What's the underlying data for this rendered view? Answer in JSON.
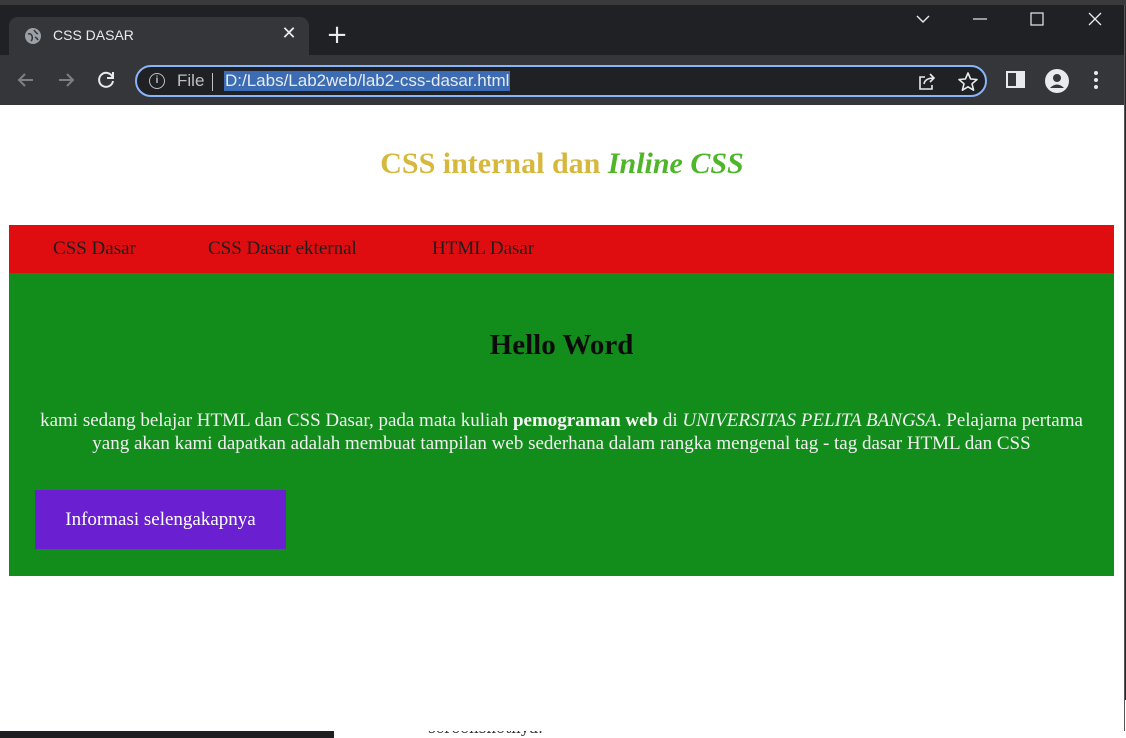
{
  "browser": {
    "tab_title": "CSS DASAR",
    "tab_close": "✕",
    "new_tab": "+",
    "omnibox": {
      "scheme_label": "File",
      "url": "D:/Labs/Lab2web/lab2-css-dasar.html"
    },
    "icons": {
      "favicon": "globe-icon",
      "back": "arrow-left-icon",
      "forward": "arrow-right-icon",
      "reload": "reload-icon",
      "info": "info-icon",
      "share": "share-icon",
      "bookmark": "star-icon",
      "sidepanel": "side-panel-icon",
      "profile": "profile-icon",
      "menu": "kebab-menu-icon"
    },
    "colors": {
      "frame": "#202124",
      "toolbar": "#35363a",
      "focus": "#8ab4f8"
    }
  },
  "page": {
    "heading_part1": "CSS internal dan ",
    "heading_part2": "Inline CSS",
    "nav": [
      "CSS Dasar",
      "CSS Dasar ekternal",
      "HTML Dasar"
    ],
    "main": {
      "title": "Hello Word",
      "para": {
        "t1": "kami sedang belajar HTML dan CSS Dasar, pada mata kuliah ",
        "bold": "pemograman web",
        "t2": " di ",
        "italic": "UNIVERSITAS PELITA BANGSA",
        "t3": ". Pelajarna pertama yang akan kami dapatkan adalah membuat tampilan web sederhana dalam rangka mengenal tag - tag dasar HTML dan CSS"
      },
      "button": "Informasi selengakapnya"
    },
    "colors": {
      "heading": "#d6b83c",
      "heading_italic": "#4fb62a",
      "nav_bg": "#e00d10",
      "content_bg": "#128c1a",
      "button_bg": "#6a1fd0"
    }
  },
  "background_text": "screenshotnya."
}
